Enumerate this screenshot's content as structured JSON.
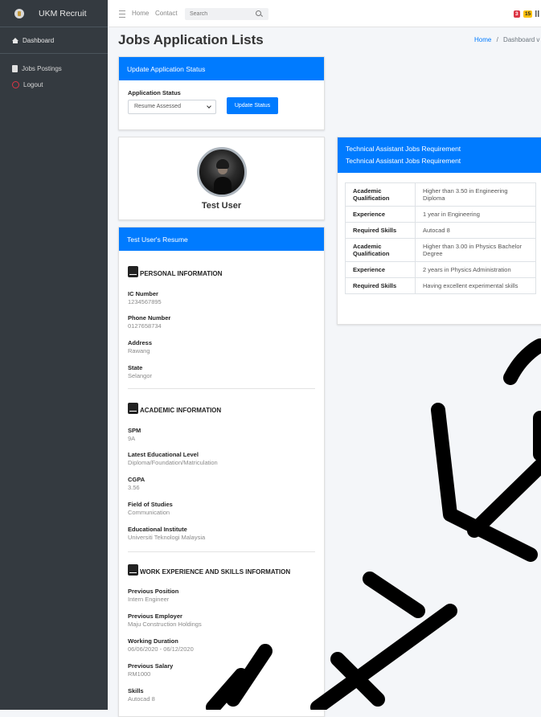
{
  "sidebar": {
    "brand": "UKM Recruit",
    "dashboard": "Dashboard",
    "items": [
      {
        "label": "Jobs Postings",
        "icon": "book-icon"
      },
      {
        "label": "Logout",
        "icon": "power-icon"
      }
    ]
  },
  "topbar": {
    "links": [
      "Home",
      "Contact"
    ],
    "search_placeholder": "Search",
    "badges": [
      "3",
      "15"
    ]
  },
  "page": {
    "title": "Jobs Application Lists",
    "breadcrumb_home": "Home",
    "breadcrumb_sep": "/",
    "breadcrumb_current": "Dashboard v"
  },
  "status_card": {
    "header": "Update Application Status",
    "label": "Application Status",
    "selected": "Resume Assessed",
    "button": "Update Status"
  },
  "profile": {
    "name": "Test User"
  },
  "resume": {
    "header": "Test User's Resume",
    "sections": [
      {
        "title": "PERSONAL INFORMATION",
        "fields": [
          {
            "label": "IC Number",
            "value": "1234567895"
          },
          {
            "label": "Phone Number",
            "value": "0127658734"
          },
          {
            "label": "Address",
            "value": "Rawang"
          },
          {
            "label": "State",
            "value": "Selangor"
          }
        ]
      },
      {
        "title": "ACADEMIC INFORMATION",
        "fields": [
          {
            "label": "SPM",
            "value": "9A"
          },
          {
            "label": "Latest Educational Level",
            "value": "Diploma/Foundation/Matriculation"
          },
          {
            "label": "CGPA",
            "value": "3.56"
          },
          {
            "label": "Field of Studies",
            "value": "Communication"
          },
          {
            "label": "Educational Institute",
            "value": "Universiti Teknologi Malaysia"
          }
        ]
      },
      {
        "title": "WORK EXPERIENCE AND SKILLS INFORMATION",
        "fields": [
          {
            "label": "Previous Position",
            "value": "Intern Engineer"
          },
          {
            "label": "Previous Employer",
            "value": "Maju Construction Holdings"
          },
          {
            "label": "Working Duration",
            "value": "06/06/2020 - 06/12/2020"
          },
          {
            "label": "Previous Salary",
            "value": "RM1000"
          },
          {
            "label": "Skills",
            "value": "Autocad 8"
          }
        ]
      }
    ]
  },
  "requirements": {
    "header_line1": "Technical Assistant Jobs Requirement",
    "header_line2": "Technical Assistant Jobs Requirement",
    "rows": [
      {
        "key": "Academic Qualification",
        "value": "Higher than 3.50 in Engineering Diploma"
      },
      {
        "key": "Experience",
        "value": "1 year in Engineering"
      },
      {
        "key": "Required Skills",
        "value": "Autocad 8"
      },
      {
        "key": "Academic Qualification",
        "value": "Higher than 3.00 in Physics Bachelor Degree"
      },
      {
        "key": "Experience",
        "value": "2 years in Physics Administration"
      },
      {
        "key": "Required Skills",
        "value": "Having excellent experimental skills"
      }
    ]
  },
  "colors": {
    "primary": "#007bff",
    "sidebar": "#343a40",
    "danger": "#dc3545",
    "warning": "#ffc107"
  }
}
